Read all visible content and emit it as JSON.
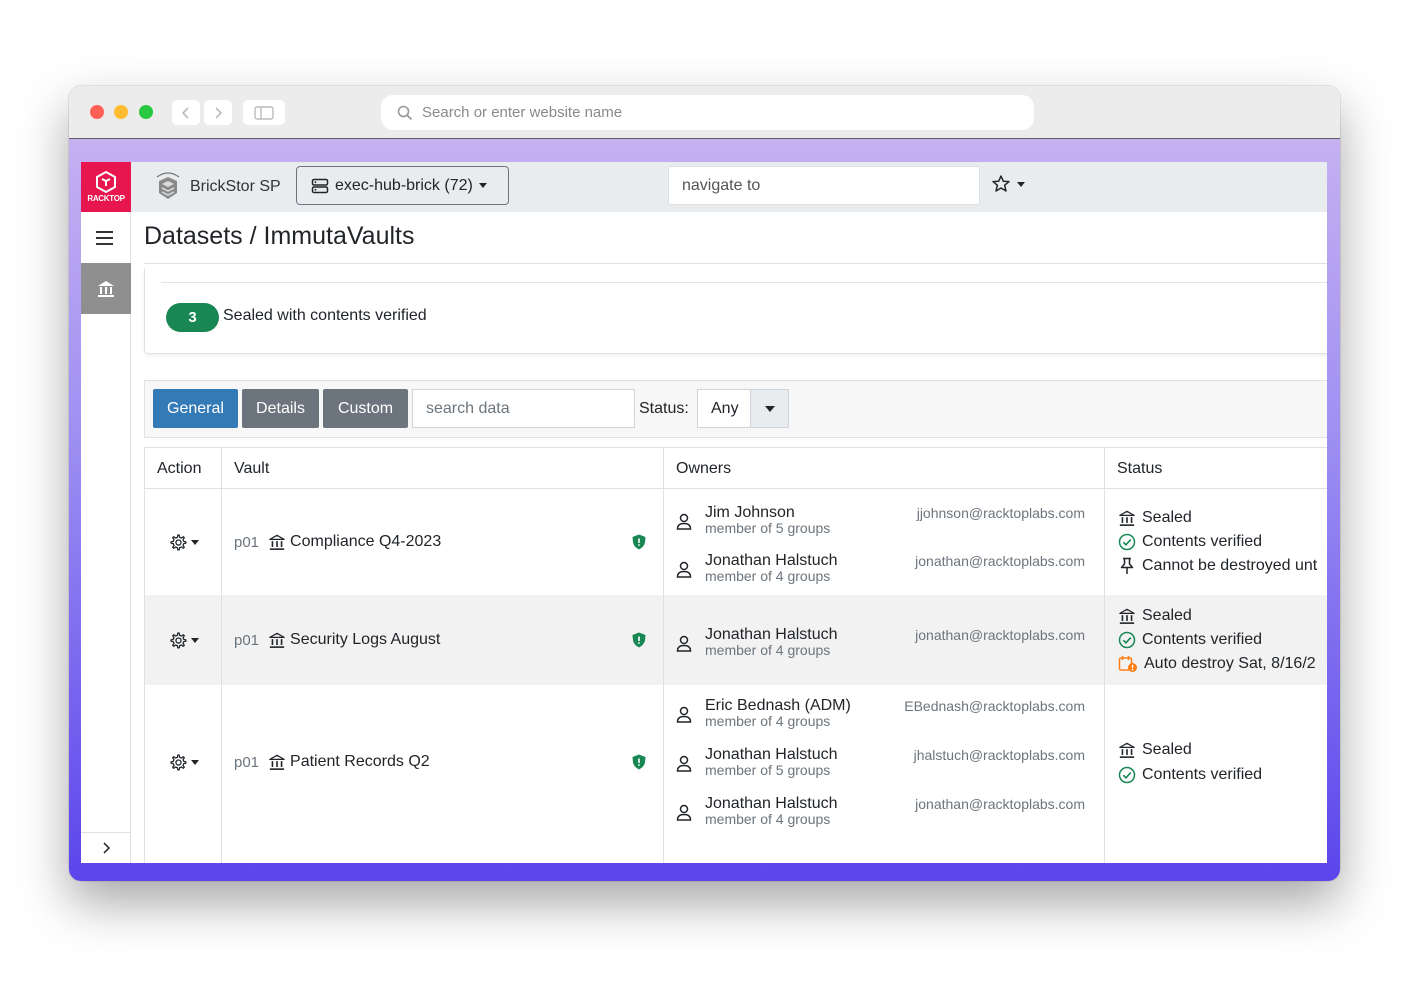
{
  "browser": {
    "url_placeholder": "Search or enter website name"
  },
  "topbar": {
    "logo_text": "RACKTOP",
    "brand_name": "BrickStor SP",
    "server_label": "exec-hub-brick (72)",
    "navigate_placeholder": "navigate to"
  },
  "page": {
    "title": "Datasets / ImmutaVaults"
  },
  "summary": {
    "count": "3",
    "label": "Sealed with contents verified"
  },
  "toolbar": {
    "tabs": [
      "General",
      "Details",
      "Custom"
    ],
    "search_placeholder": "search data",
    "status_label": "Status:",
    "status_value": "Any"
  },
  "table": {
    "headers": [
      "Action",
      "Vault",
      "Owners",
      "Status"
    ],
    "rows": [
      {
        "pool": "p01",
        "vault": "Compliance Q4-2023",
        "owners": [
          {
            "name": "Jim Johnson",
            "groups": "member of 5 groups",
            "email": "jjohnson@racktoplabs.com"
          },
          {
            "name": "Jonathan Halstuch",
            "groups": "member of 4 groups",
            "email": "jonathan@racktoplabs.com"
          }
        ],
        "status": [
          "Sealed",
          "Contents verified",
          "Cannot be destroyed unt"
        ]
      },
      {
        "pool": "p01",
        "vault": "Security Logs August",
        "owners": [
          {
            "name": "Jonathan Halstuch",
            "groups": "member of 4 groups",
            "email": "jonathan@racktoplabs.com"
          }
        ],
        "status": [
          "Sealed",
          "Contents verified",
          "Auto destroy Sat, 8/16/2"
        ]
      },
      {
        "pool": "p01",
        "vault": "Patient Records Q2",
        "owners": [
          {
            "name": "Eric Bednash (ADM)",
            "groups": "member of 4 groups",
            "email": "EBednash@racktoplabs.com"
          },
          {
            "name": "Jonathan Halstuch",
            "groups": "member of 5 groups",
            "email": "jhalstuch@racktoplabs.com"
          },
          {
            "name": "Jonathan Halstuch",
            "groups": "member of 4 groups",
            "email": "jonathan@racktoplabs.com"
          }
        ],
        "status": [
          "Sealed",
          "Contents verified"
        ]
      }
    ]
  },
  "colors": {
    "logo": "#e8164f",
    "primary_tab": "#337ab7",
    "secondary_tab": "#6c757d",
    "success": "#198754",
    "warning": "#fd7e14",
    "shield": "#198754"
  }
}
